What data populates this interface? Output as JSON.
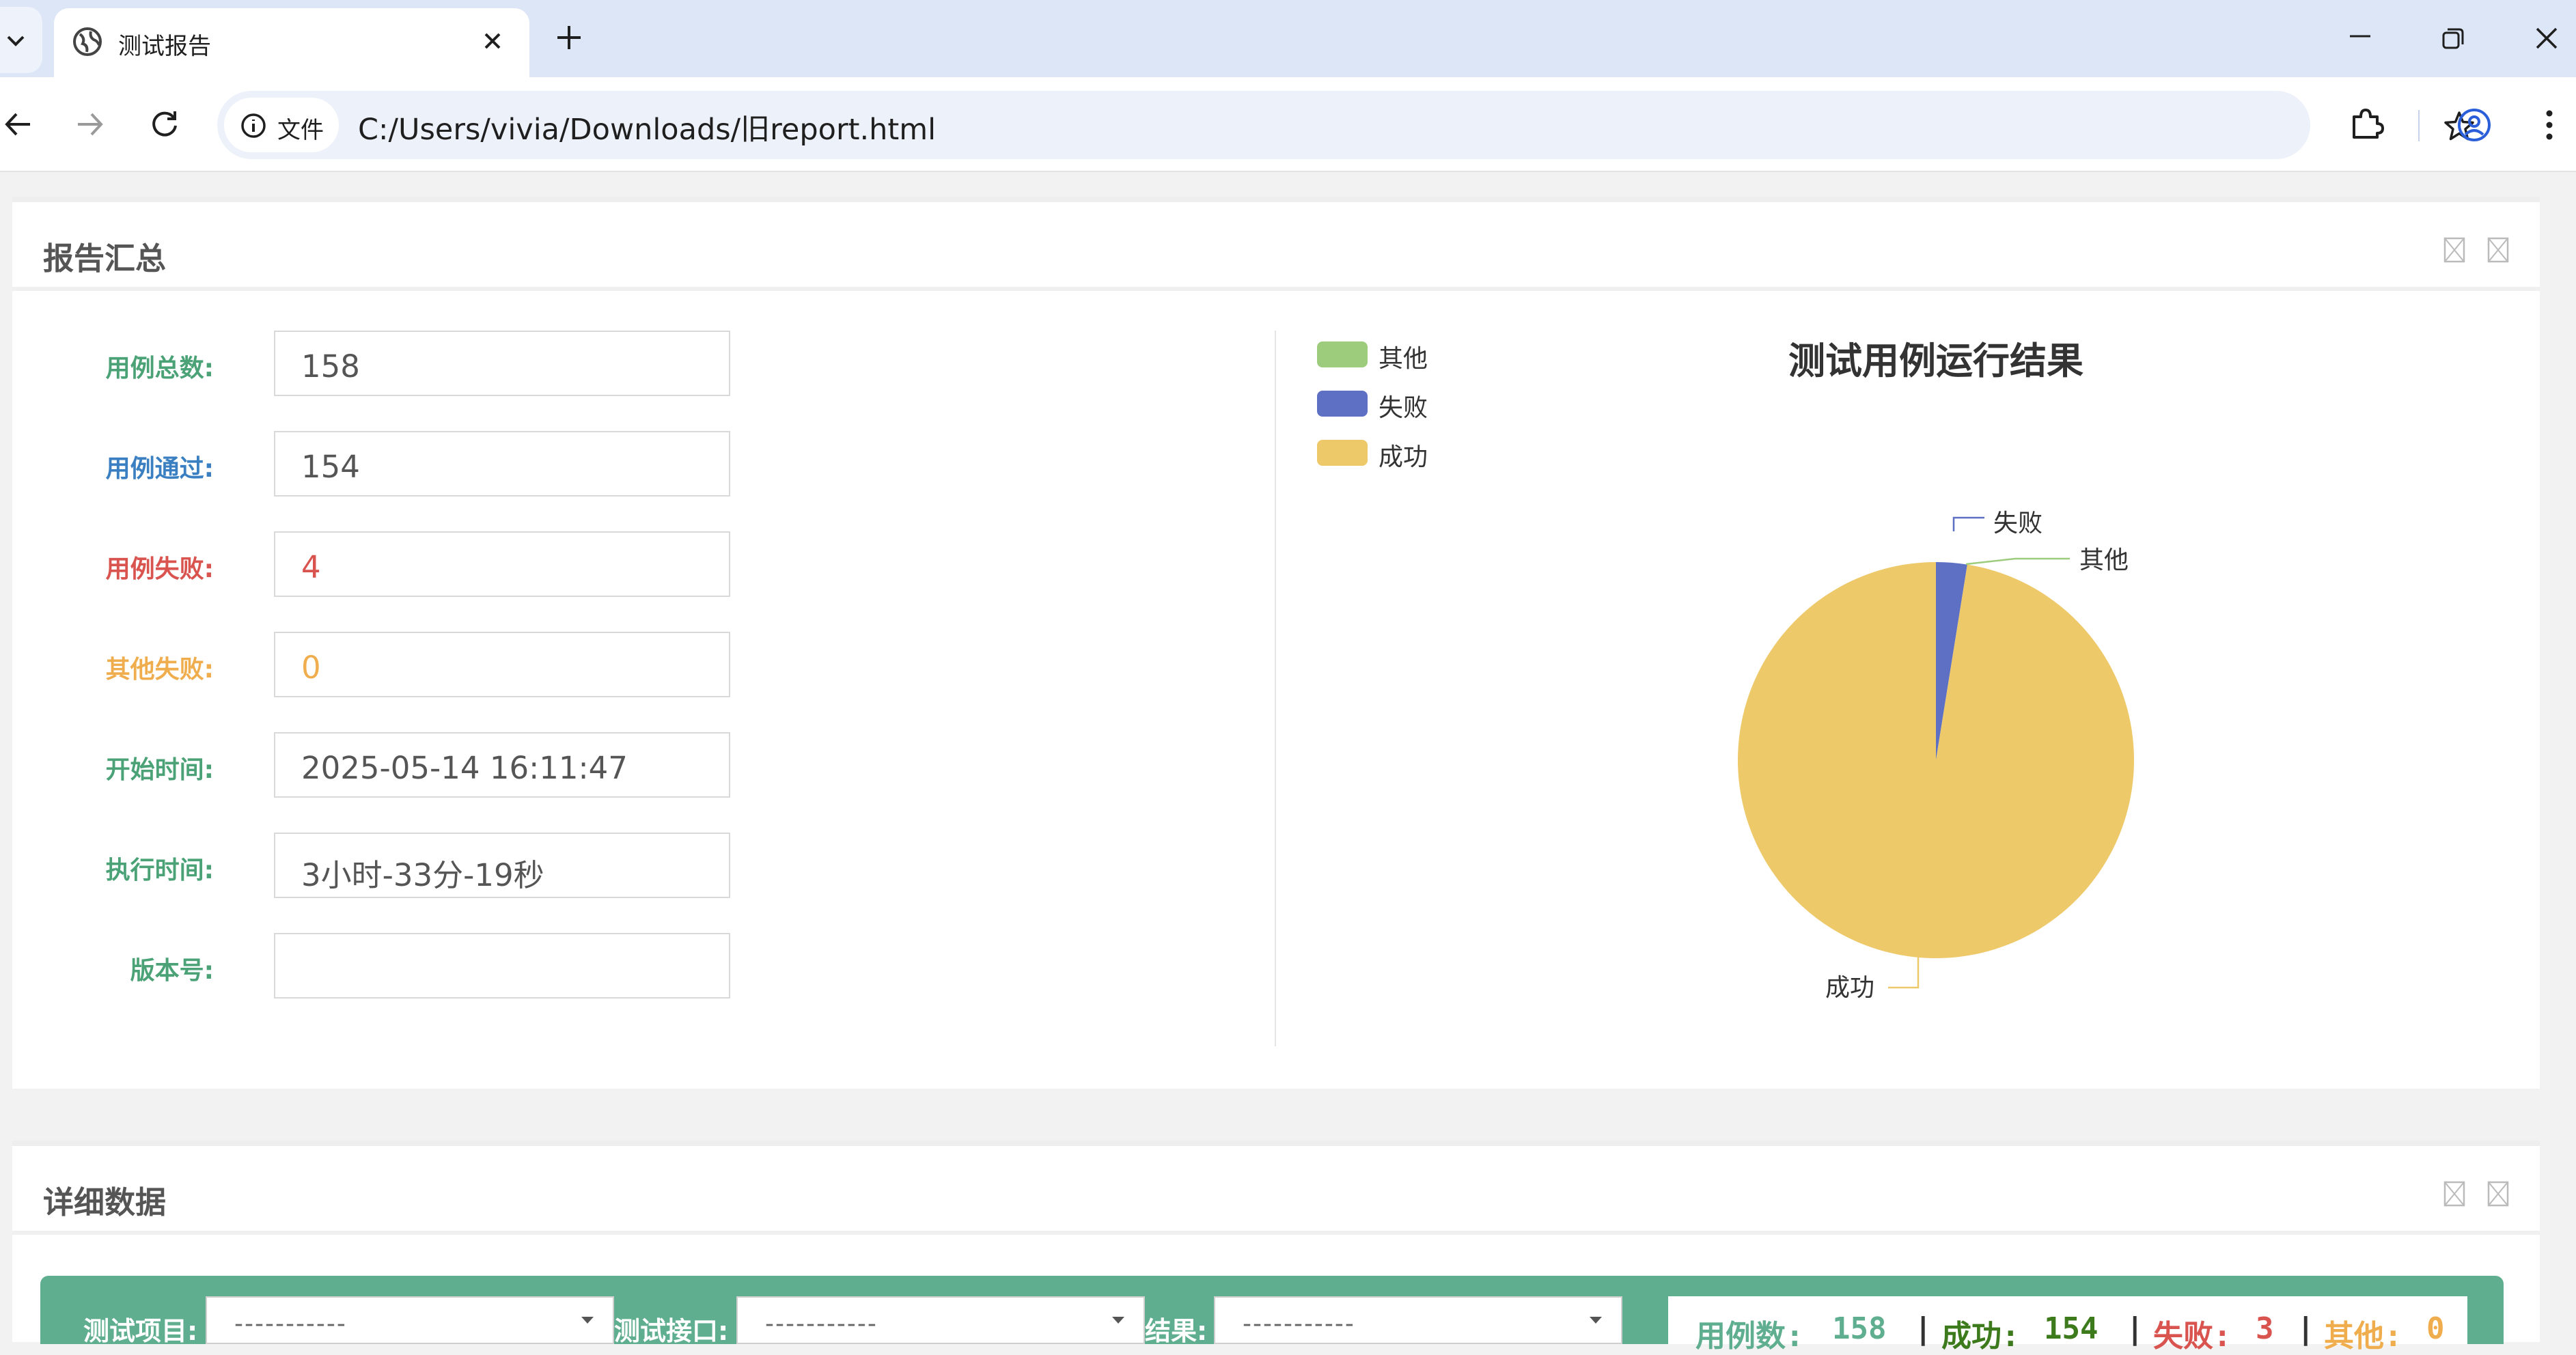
{
  "browser": {
    "tab_title": "测试报告",
    "address_chip": "文件",
    "url": "C:/Users/vivia/Downloads/旧report.html"
  },
  "summary": {
    "title": "报告汇总",
    "fields": [
      {
        "label": "用例总数:",
        "value": "158",
        "label_color": "#4aa276",
        "value_color": "#555555"
      },
      {
        "label": "用例通过:",
        "value": "154",
        "label_color": "#3a7fc1",
        "value_color": "#555555"
      },
      {
        "label": "用例失败:",
        "value": "4",
        "label_color": "#d9534f",
        "value_color": "#d9534f"
      },
      {
        "label": "其他失败:",
        "value": "0",
        "label_color": "#f0ad4e",
        "value_color": "#f0ad4e"
      },
      {
        "label": "开始时间:",
        "value": "2025-05-14 16:11:47",
        "label_color": "#4aa276",
        "value_color": "#555555"
      },
      {
        "label": "执行时间:",
        "value": "3小时-33分-19秒",
        "label_color": "#4aa276",
        "value_color": "#555555"
      },
      {
        "label": "版本号:",
        "value": "",
        "label_color": "#4aa276",
        "value_color": "#555555"
      }
    ]
  },
  "chart_data": {
    "type": "pie",
    "title": "测试用例运行结果",
    "legend": [
      "其他",
      "失败",
      "成功"
    ],
    "legend_position": "top-left",
    "slices": [
      {
        "label": "成功",
        "value": 154,
        "color": "#eec96a"
      },
      {
        "label": "失败",
        "value": 4,
        "color": "#5d70c4"
      },
      {
        "label": "其他",
        "value": 0,
        "color": "#9ccc7c"
      }
    ]
  },
  "details": {
    "title": "详细数据",
    "filters": [
      {
        "label": "测试项目:",
        "value": "-----------"
      },
      {
        "label": "测试接口:",
        "value": "-----------"
      },
      {
        "label": "结果:",
        "value": "-----------"
      }
    ],
    "stats": {
      "total_label": "用例数:",
      "total": "158",
      "success_label": "成功:",
      "success": "154",
      "fail_label": "失败:",
      "fail": "3",
      "other_label": "其他:",
      "other": "0",
      "separator": "|"
    }
  }
}
